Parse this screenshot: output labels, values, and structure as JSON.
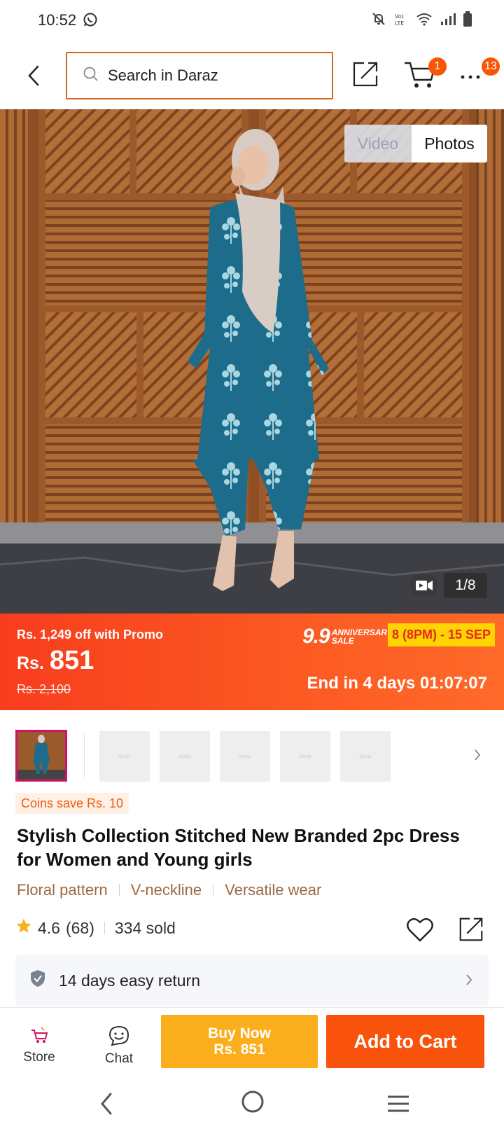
{
  "status_bar": {
    "time": "10:52",
    "network": "LTE"
  },
  "header": {
    "search_placeholder": "Search in Daraz",
    "cart_count": "1",
    "more_count": "13"
  },
  "media": {
    "video_tab": "Video",
    "photos_tab": "Photos",
    "counter": "1/8"
  },
  "promo": {
    "off_text": "Rs. 1,249 off with Promo",
    "currency": "Rs.",
    "price": "851",
    "old_price": "Rs. 2,100",
    "sale_number": "9.9",
    "sale_label_1": "ANNIVERSARY",
    "sale_label_2": "SALE",
    "sale_dates": "8 (8PM) - 15 SEP",
    "countdown": "End in 4 days 01:07:07"
  },
  "thumbnails": {
    "placeholder_label": "daraz",
    "count_placeholders": 5
  },
  "coins": "Coins save Rs. 10",
  "product": {
    "title": "Stylish Collection Stitched New Branded 2pc Dress for Women and Young girls",
    "tags": [
      "Floral pattern",
      "V-neckline",
      "Versatile wear"
    ],
    "rating": "4.6",
    "reviews": "(68)",
    "sold": "334 sold"
  },
  "return_policy": "14 days easy return",
  "bottom_bar": {
    "store_label": "Store",
    "chat_label": "Chat",
    "buy_now_label": "Buy Now",
    "buy_now_price": "Rs. 851",
    "add_to_cart_label": "Add to Cart"
  },
  "colors": {
    "brand_orange": "#f85606",
    "buy_now_yellow": "#fbae1c",
    "tag_brown": "#9b6a45",
    "star": "#f8b21c"
  }
}
